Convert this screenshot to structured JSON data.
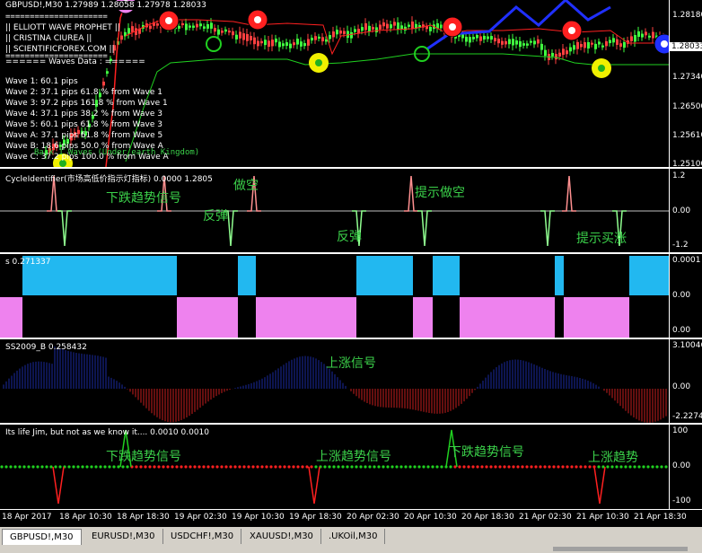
{
  "main_chart": {
    "symbol_label": "GBPUSD!,M30  1.27989 1.28058 1.27978 1.28033",
    "info_lines": [
      "=====================",
      "||  ELLIOTT WAVE PROPHET  ||",
      "||     CRISTINA CIUREA     ||",
      "||   SCIENTIFICFOREX.COM   ||",
      "=====================",
      "====== Waves Data : ======"
    ],
    "waves": [
      "Wave 1: 60.1 pips",
      "Wave 2: 37.1 pips 61.8 % from Wave 1",
      "Wave 3: 97.2 pips 161.8 % from Wave 1",
      "Wave 4: 37.1 pips 38.2 % from Wave 3",
      "Wave 5: 60.1 pips 61.8 % from Wave 3",
      "Wave A: 37.1 pips 61.8 % from Wave 5",
      "Wave B: 18.6 pips 50.0 % from Wave A",
      "Wave C: 37.2 pips 100.0 % from Wave A"
    ],
    "underlay_text": "Back 1 Waves (Under earth Kingdom)",
    "price_ticks": [
      "1.28180",
      "1.28033",
      "1.27340",
      "1.26500",
      "1.25610",
      "1.25100"
    ],
    "current_price": "1.28033"
  },
  "cycle_panel": {
    "label": "CycleIdentifier(市场高低价指示灯指标)  0.0000 1.2805",
    "ticks": [
      "1.2",
      "0.00",
      "-1.2"
    ],
    "annotations": [
      "下跌趋势信号",
      "做空",
      "反弹",
      "反弹",
      "提示做空",
      "提示买涨"
    ]
  },
  "s_panel": {
    "label": "s 0.271337",
    "ticks": [
      "0.0001",
      "0.00",
      "0.00"
    ]
  },
  "ss_panel": {
    "label": "SS2009_B 0.258432",
    "ticks": [
      "3.10046",
      "0.00",
      "-2.22741"
    ],
    "annotations": [
      "上涨信号"
    ]
  },
  "jim_panel": {
    "label": "Its life Jim, but not as we know it....  0.0010 0.0010",
    "ticks": [
      "100",
      "0.00",
      "-100"
    ],
    "annotations": [
      "下跌趋势信号",
      "上涨趋势信号",
      "下跌趋势信号",
      "上涨趋势"
    ]
  },
  "time_axis": [
    "18 Apr 2017",
    "18 Apr 10:30",
    "18 Apr 18:30",
    "19 Apr 02:30",
    "19 Apr 10:30",
    "19 Apr 18:30",
    "20 Apr 02:30",
    "20 Apr 10:30",
    "20 Apr 18:30",
    "21 Apr 02:30",
    "21 Apr 10:30",
    "21 Apr 18:30"
  ],
  "tabs": [
    "GBPUSD!,M30",
    "EURUSD!,M30",
    "USDCHF!,M30",
    "XAUUSD!,M30",
    ".UKOil,M30"
  ],
  "colors": {
    "bull": "#00c000",
    "bear": "#e02020",
    "wave_blue": "#2030ff",
    "cyan": "#22b8f0",
    "violet": "#ee82ee",
    "navy": "#1a2aa0",
    "hist_red": "#c81e1e"
  }
}
